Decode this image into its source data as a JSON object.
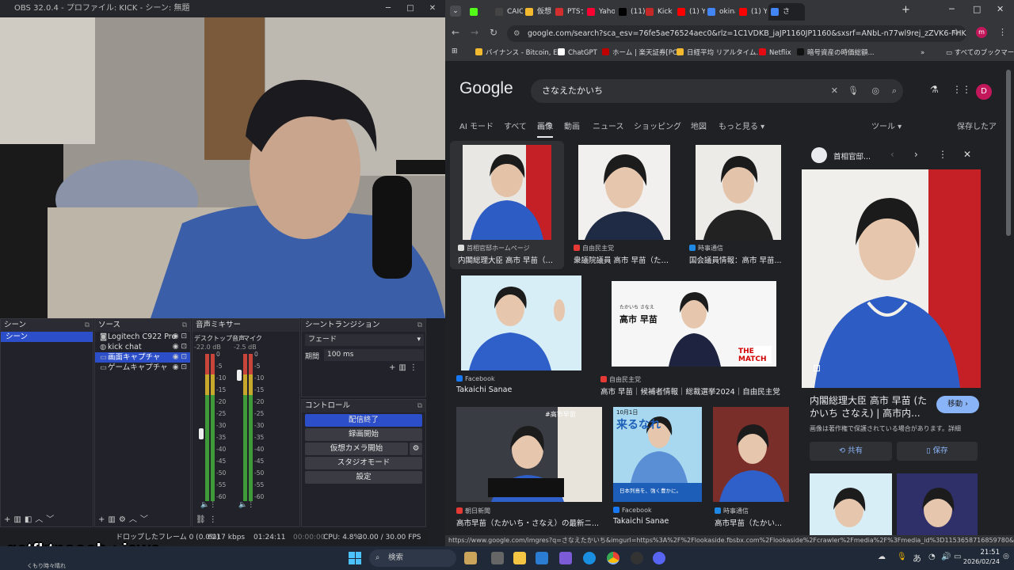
{
  "obs": {
    "title": "OBS 32.0.4 - プロファイル: KICK - シーン: 無題",
    "scenes": {
      "header": "シーン",
      "items": [
        "シーン"
      ]
    },
    "sources": {
      "header": "ソース",
      "items": [
        {
          "icon": "camera-icon",
          "label": "Logitech C922 Pro"
        },
        {
          "icon": "globe-icon",
          "label": "kick chat"
        },
        {
          "icon": "monitor-icon",
          "label": "画面キャプチャ"
        },
        {
          "icon": "gamepad-icon",
          "label": "ゲームキャプチャ"
        }
      ]
    },
    "mixer": {
      "header": "音声ミキサー",
      "ch1": {
        "name": "デスクトップ音声",
        "db": "-22.0 dB"
      },
      "ch2": {
        "name": "マイク",
        "db": "-2.5 dB"
      },
      "ticks": [
        "0",
        "-5",
        "-10",
        "-15",
        "-20",
        "-25",
        "-30",
        "-35",
        "-40",
        "-45",
        "-50",
        "-55",
        "-60"
      ]
    },
    "transition": {
      "header": "シーントランジション",
      "value": "フェード",
      "duration_label": "期間",
      "duration": "100 ms"
    },
    "controls": {
      "header": "コントロール",
      "buttons": [
        "配信終了",
        "録画開始",
        "仮想カメラ開始",
        "スタジオモード",
        "設定"
      ]
    },
    "status": {
      "dropped": "ドロップしたフレーム 0 (0.0%)",
      "bitrate": "6217 kbps",
      "live_time": "01:24:11",
      "rec_time": "00:00:00",
      "cpu": "CPU: 4.8%",
      "fps": "30.00 / 30.00 FPS"
    }
  },
  "chrome": {
    "tabs": [
      {
        "label": "",
        "color": "#53fc18"
      },
      {
        "label": "CAIC/",
        "color": "#444"
      },
      {
        "label": "仮想",
        "color": "#f3ba2f"
      },
      {
        "label": "PTSナ",
        "color": "#d32f2f"
      },
      {
        "label": "Yahoo",
        "color": "#ff0033"
      },
      {
        "label": "(11)",
        "color": "#000"
      },
      {
        "label": "Kick",
        "color": "#c62828"
      },
      {
        "label": "(1) Yo",
        "color": "#ff0000"
      },
      {
        "label": "okina",
        "color": "#4285f4"
      },
      {
        "label": "(1) Yo",
        "color": "#ff0000"
      },
      {
        "label": "さ",
        "color": "#4285f4"
      }
    ],
    "url": "google.com/search?sca_esv=76fe5ae76524aec0&rlz=1C1VDKB_jaJP1160JP1160&sxsrf=ANbL-n77wl9rej_zZVK6-FHKmuwuh95...",
    "bookmarks": [
      "バイナンス - Bitcoin, E...",
      "ChatGPT",
      "ホーム | 楽天証券[PC]",
      "日経平均 リアルタイム...",
      "Netflix",
      "暗号資産の時価総額..."
    ],
    "all_bookmarks": "すべてのブックマーク",
    "profile": "m"
  },
  "google": {
    "logo": "Google",
    "query": "さなえたかいち",
    "nav": [
      "AI モード",
      "すべて",
      "画像",
      "動画",
      "ニュース",
      "ショッピング",
      "地図",
      "もっと見る"
    ],
    "tools": "ツール",
    "saved": "保存したア",
    "account": "D",
    "results": [
      {
        "source": "首相官邸ホームページ",
        "title": "内閣総理大臣 高市 早苗（た..."
      },
      {
        "source": "自由民主党",
        "title": "衆議院議員 高市 早苗（たか..."
      },
      {
        "source": "時事通信",
        "title": "国会議員情報：高市 早苗..."
      },
      {
        "source": "Facebook",
        "title": "Takaichi Sanae"
      },
      {
        "source": "自由民主党",
        "title": "高市 早苗｜候補者情報｜総裁選挙2024｜自由民主党"
      },
      {
        "source": "朝日新聞",
        "title": "高市早苗（たかいち・さなえ）の最新ニ..."
      },
      {
        "source": "Facebook",
        "title": "Takaichi Sanae"
      },
      {
        "source": "時事通信",
        "title": "高市早苗（たかい..."
      }
    ],
    "img_texts": {
      "banner_name": "高市 早苗",
      "banner_kana": "たかいち さなえ",
      "banner_logo": "THE MATCH",
      "poster": "#高市早苗",
      "date": "10月1日",
      "slogan": "来るなれ",
      "sub": "日本列島を、強く豊かに。"
    },
    "panel": {
      "source": "首相官邸...",
      "title": "内閣総理大臣 高市 早苗 (たかいち さなえ) | 高市内...",
      "move": "移動",
      "note": "画像は著作権で保護されている場合があります。詳細",
      "share": "共有",
      "save": "保存"
    },
    "status_url": "https://www.google.com/imgres?q=さなえたかいち&imgurl=https%3A%2F%2Flookaside.fbsbx.com%2Flookaside%2Fcrawler%2Fmedia%2F%3Fmedia_id%3D1153658716859780&imgrefurl=https%..."
  },
  "overlay": {
    "chat": "getfktnooob : jews",
    "weather": "くもり時々晴れ"
  },
  "taskbar": {
    "search": "検索",
    "time": "21:51",
    "date": "2026/02/24",
    "ime": "あ"
  }
}
